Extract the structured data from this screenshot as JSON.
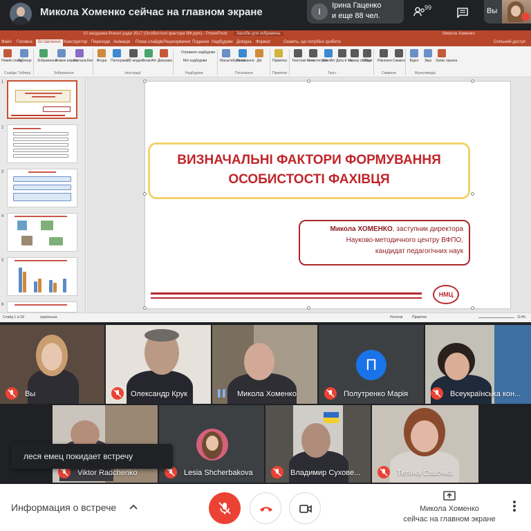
{
  "topbar": {
    "presenting_title": "Микола Хоменко сейчас на главном экране",
    "participants_chip": {
      "initial": "I",
      "line1": "Ірина Гаценко",
      "line2": "и еще 88 чел."
    },
    "people_count": "99",
    "self_label": "Вы"
  },
  "ppt": {
    "title_center": "10 засідання Вченої ради 2017 (Особистісні фактори ВФ.pptx) - PowerPoint",
    "title_tools": "Засоби для зображень",
    "title_user": "Микола Хоменко",
    "tabs": [
      "Файл",
      "Головна",
      "Вставлення",
      "Конструктор",
      "Переходи",
      "Анімація",
      "Показ слайдів",
      "Рецензування",
      "Подання",
      "Надбудови",
      "Довідка",
      "Формат"
    ],
    "tell_me": "Скажіть, що потрібно зробити",
    "share": "Спільний доступ",
    "ribbon_groups": [
      "Слайди",
      "Таблиці",
      "Зображення",
      "Ілюстрації",
      "Надбудови",
      "Посилання",
      "Примітки",
      "Текст",
      "Символи",
      "Мультимедіа"
    ],
    "ribbon_buttons": [
      {
        "label": "Новий слайд",
        "color": "#c55a3b"
      },
      {
        "label": "Таблиця",
        "color": "#6b8fc7"
      },
      {
        "label": "Зображення",
        "color": "#4aa36b"
      },
      {
        "label": "Знімок екрана",
        "color": "#6b8fc7"
      },
      {
        "label": "Фотоальбом",
        "color": "#8a6bc7"
      },
      {
        "label": "Фігури",
        "color": "#d08a3c"
      },
      {
        "label": "Піктограми",
        "color": "#3c89d0"
      },
      {
        "label": "3D моделі",
        "color": "#5a5a5a"
      },
      {
        "label": "SmartArt",
        "color": "#4aa36b"
      },
      {
        "label": "Діаграма",
        "color": "#c55a3b"
      },
      {
        "label": "Отримати надбудови",
        "color": "#6b8fc7"
      },
      {
        "label": "Мої надбудови",
        "color": "#6b8fc7"
      },
      {
        "label": "Масштабування",
        "color": "#6b8fc7"
      },
      {
        "label": "Посилання",
        "color": "#3c89d0"
      },
      {
        "label": "Дія",
        "color": "#d08a3c"
      },
      {
        "label": "Примітка",
        "color": "#d0b33c"
      },
      {
        "label": "Текстове поле",
        "color": "#5a5a5a"
      },
      {
        "label": "Колонтитули",
        "color": "#5a5a5a"
      },
      {
        "label": "WordArt",
        "color": "#3c89d0"
      },
      {
        "label": "Дата й час",
        "color": "#5a5a5a"
      },
      {
        "label": "Номер слайда",
        "color": "#5a5a5a"
      },
      {
        "label": "Об'єкт",
        "color": "#5a5a5a"
      },
      {
        "label": "Рівняння",
        "color": "#5a5a5a"
      },
      {
        "label": "Символ",
        "color": "#5a5a5a"
      },
      {
        "label": "Відео",
        "color": "#6b8fc7"
      },
      {
        "label": "Звук",
        "color": "#6b8fc7"
      },
      {
        "label": "Запис екрана",
        "color": "#c55a3b"
      }
    ],
    "thumb_numbers": [
      "1",
      "2",
      "3",
      "4",
      "5",
      "6"
    ],
    "slide": {
      "title_line1": "ВИЗНАЧАЛЬНІ ФАКТОРИ ФОРМУВАННЯ",
      "title_line2": "ОСОБИСТОСТІ ФАХІВЦЯ",
      "author_name": "Микола ХОМЕНКО",
      "author_line1_rest": ", заступник директора",
      "author_line2": "Науково-методичного центру ВФПО,",
      "author_line3": "кандидат педагогічних наук",
      "logo": "НМЦ"
    },
    "status": {
      "slide_info": "Слайд 1 із 29",
      "language": "українська",
      "notes": "Нотатки",
      "comments": "Примітки",
      "zoom": "114%"
    }
  },
  "participants": [
    {
      "name": "Вы",
      "muted": true
    },
    {
      "name": "Олександр Крук",
      "muted": true
    },
    {
      "name": "Микола Хоменко",
      "muted": false,
      "speaking": true
    },
    {
      "name": "Полутренко Марія",
      "muted": true,
      "initial": "П"
    },
    {
      "name": "Всеукраїнська кон...",
      "muted": true
    },
    {
      "name": "Viktor Radchenko",
      "muted": true
    },
    {
      "name": "Lesia Shcherbakova",
      "muted": true
    },
    {
      "name": "Владимир Сухове...",
      "muted": true
    },
    {
      "name": "Тетяна Савочка",
      "muted": true
    }
  ],
  "toast": "леся емец покидает встречу",
  "bottombar": {
    "meeting_info": "Информация о встрече",
    "present_line1": "Микола Хоменко",
    "present_line2": "сейчас на главном экране"
  },
  "colors": {
    "meet_dark": "#202124",
    "tile": "#3c4043",
    "danger": "#ea4335",
    "ppt_accent": "#b7472a",
    "slide_red": "#c0252a"
  }
}
